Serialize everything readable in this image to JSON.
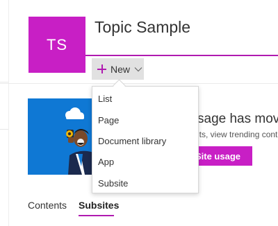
{
  "site": {
    "logo_initials": "TS",
    "title": "Topic Sample"
  },
  "command_bar": {
    "new_label": "New"
  },
  "new_menu": {
    "items": [
      "List",
      "Page",
      "Document library",
      "App",
      "Subsite"
    ]
  },
  "banner": {
    "heading_partial": "sage has moved",
    "subtext_partial": "its, view trending cont",
    "button_label": "Site usage"
  },
  "tabs": [
    {
      "label": "Contents",
      "selected": false
    },
    {
      "label": "Subsites",
      "selected": true
    }
  ],
  "colors": {
    "accent": "#b01ab0",
    "logo_bg": "#c81fc5",
    "banner_blue": "#0f78d4"
  }
}
